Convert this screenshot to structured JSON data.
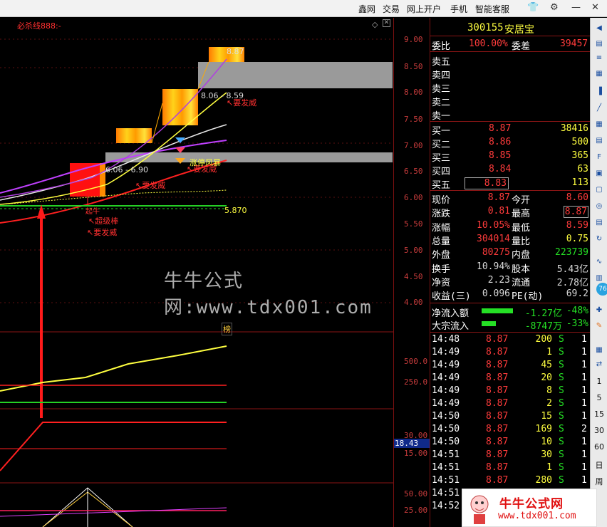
{
  "menu": {
    "items": [
      "鑫网",
      "交易",
      "网上开户",
      "手机",
      "智能客服"
    ],
    "window_controls": [
      "shirt-icon",
      "settings-icon",
      "minimize-icon",
      "close-icon"
    ]
  },
  "chart": {
    "indicator_name": "必杀线888:-",
    "price_axis": [
      "9.00",
      "8.50",
      "8.00",
      "7.50",
      "7.00",
      "6.50",
      "6.00",
      "5.50",
      "5.00",
      "4.50",
      "4.00"
    ],
    "vol_axis": [
      "500.0",
      "250.0"
    ],
    "osc_axis": [
      "30.00",
      "15.00"
    ],
    "osc_value": "18.43",
    "osc2_axis": [
      "50.00",
      "25.00"
    ],
    "labels": {
      "range_top": "8.87",
      "range_mid": "8.06 - 8.59",
      "range_low": "6.06 - 6.90",
      "signal_1": "↖要发威",
      "signal_2": "↖要发威",
      "signal_3": "↖要发威",
      "signal_4": "涨停风暴",
      "signal_5": "↖超级棒",
      "signal_6": "↖要发威",
      "signal_7": "起牛",
      "base_value": "5.870",
      "rank_tag": "榜"
    }
  },
  "quote": {
    "code": "300155",
    "name": "安居宝",
    "weibi_label": "委比",
    "weibi": "100.00%",
    "weicha_label": "委差",
    "weicha": "39457",
    "sell": [
      {
        "label": "卖五",
        "price": "",
        "vol": ""
      },
      {
        "label": "卖四",
        "price": "",
        "vol": ""
      },
      {
        "label": "卖三",
        "price": "",
        "vol": ""
      },
      {
        "label": "卖二",
        "price": "",
        "vol": ""
      },
      {
        "label": "卖一",
        "price": "",
        "vol": ""
      }
    ],
    "buy": [
      {
        "label": "买一",
        "price": "8.87",
        "vol": "38416"
      },
      {
        "label": "买二",
        "price": "8.86",
        "vol": "500"
      },
      {
        "label": "买三",
        "price": "8.85",
        "vol": "365"
      },
      {
        "label": "买四",
        "price": "8.84",
        "vol": "63"
      },
      {
        "label": "买五",
        "price": "8.83",
        "vol": "113"
      }
    ],
    "stats": [
      {
        "l1": "现价",
        "v1": "8.87",
        "l2": "今开",
        "v2": "8.60"
      },
      {
        "l1": "涨跌",
        "v1": "0.81",
        "l2": "最高",
        "v2": "8.87"
      },
      {
        "l1": "涨幅",
        "v1": "10.05%",
        "l2": "最低",
        "v2": "8.59"
      },
      {
        "l1": "总量",
        "v1": "304014",
        "l2": "量比",
        "v2": "0.75"
      },
      {
        "l1": "外盘",
        "v1": "80275",
        "l2": "内盘",
        "v2": "223739"
      },
      {
        "l1": "换手",
        "v1": "10.94%",
        "l2": "股本",
        "v2": "5.43亿"
      },
      {
        "l1": "净资",
        "v1": "2.23",
        "l2": "流通",
        "v2": "2.78亿"
      },
      {
        "l1": "收益(三)",
        "v1": "0.096",
        "l2": "PE(动)",
        "v2": "69.2"
      }
    ],
    "flows": [
      {
        "label": "净流入额",
        "value": "-1.27亿",
        "pct": "-48%"
      },
      {
        "label": "大宗流入",
        "value": "-8747万",
        "pct": "-33%"
      }
    ],
    "ticks": [
      {
        "t": "14:48",
        "p": "8.87",
        "v": "200",
        "s": "S",
        "n": "1"
      },
      {
        "t": "14:49",
        "p": "8.87",
        "v": "1",
        "s": "S",
        "n": "1"
      },
      {
        "t": "14:49",
        "p": "8.87",
        "v": "45",
        "s": "S",
        "n": "1"
      },
      {
        "t": "14:49",
        "p": "8.87",
        "v": "20",
        "s": "S",
        "n": "1"
      },
      {
        "t": "14:49",
        "p": "8.87",
        "v": "8",
        "s": "S",
        "n": "1"
      },
      {
        "t": "14:49",
        "p": "8.87",
        "v": "2",
        "s": "S",
        "n": "1"
      },
      {
        "t": "14:50",
        "p": "8.87",
        "v": "15",
        "s": "S",
        "n": "1"
      },
      {
        "t": "14:50",
        "p": "8.87",
        "v": "169",
        "s": "S",
        "n": "2"
      },
      {
        "t": "14:50",
        "p": "8.87",
        "v": "10",
        "s": "S",
        "n": "1"
      },
      {
        "t": "14:51",
        "p": "8.87",
        "v": "30",
        "s": "S",
        "n": "1"
      },
      {
        "t": "14:51",
        "p": "8.87",
        "v": "1",
        "s": "S",
        "n": "1"
      },
      {
        "t": "14:51",
        "p": "8.87",
        "v": "280",
        "s": "S",
        "n": "1"
      },
      {
        "t": "14:51",
        "p": "",
        "v": "",
        "s": "",
        "n": ""
      },
      {
        "t": "14:52",
        "p": "",
        "v": "",
        "s": "",
        "n": ""
      }
    ]
  },
  "toolbar": {
    "periods": [
      "1",
      "5",
      "15",
      "30",
      "60",
      "日",
      "周"
    ],
    "badge": "76"
  },
  "watermark": "牛牛公式网:www.tdx001.com",
  "logo": {
    "title": "牛牛公式网",
    "url": "www.tdx001.com"
  }
}
